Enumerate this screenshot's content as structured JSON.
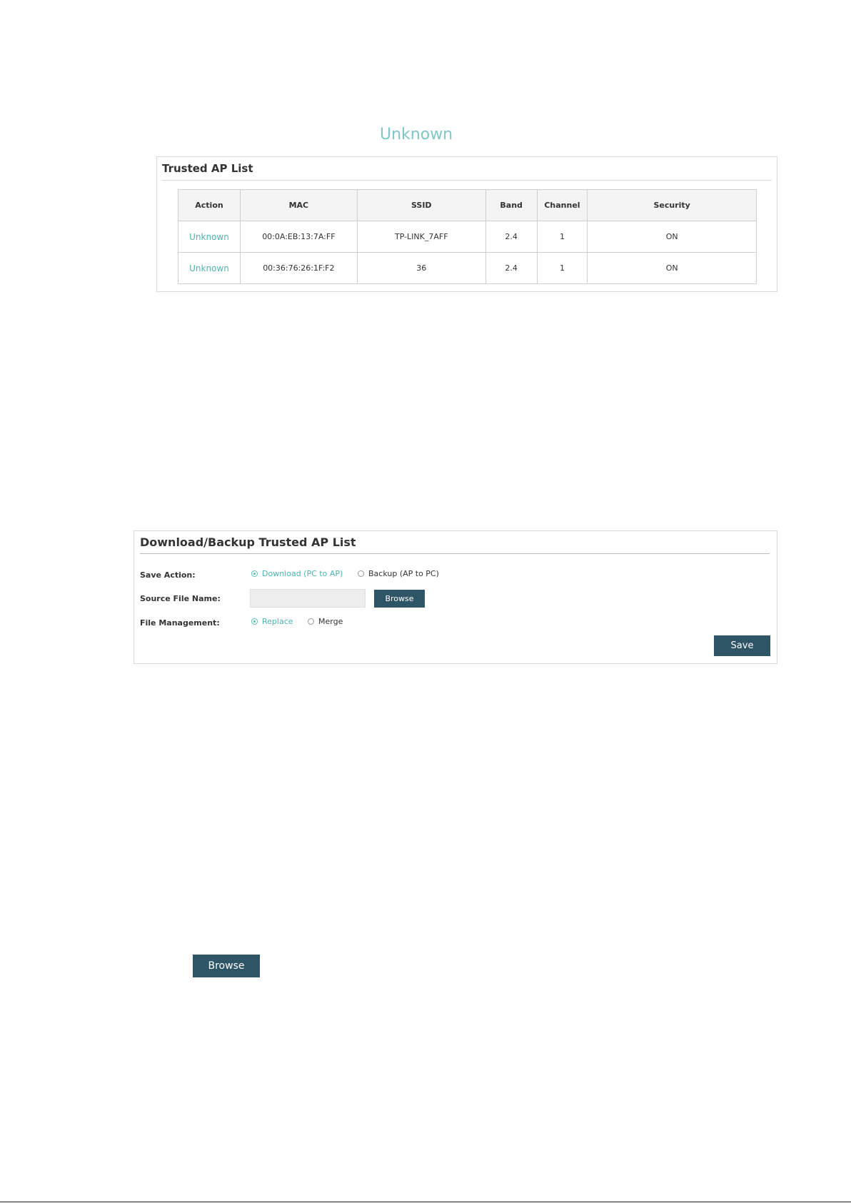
{
  "heading": "Unknown",
  "trusted_ap_list": {
    "title": "Trusted AP List",
    "columns": [
      "Action",
      "MAC",
      "SSID",
      "Band",
      "Channel",
      "Security"
    ],
    "rows": [
      {
        "action": "Unknown",
        "mac": "00:0A:EB:13:7A:FF",
        "ssid": "TP-LINK_7AFF",
        "band": "2.4",
        "channel": "1",
        "security": "ON"
      },
      {
        "action": "Unknown",
        "mac": "00:36:76:26:1F:F2",
        "ssid": "36",
        "band": "2.4",
        "channel": "1",
        "security": "ON"
      }
    ]
  },
  "backup_panel": {
    "title": "Download/Backup Trusted AP List",
    "save_action": {
      "label": "Save Action:",
      "options": [
        {
          "label": "Download (PC to AP)",
          "selected": true
        },
        {
          "label": "Backup (AP to PC)",
          "selected": false
        }
      ]
    },
    "source_file": {
      "label": "Source File Name:",
      "value": "",
      "browse_label": "Browse"
    },
    "file_management": {
      "label": "File Management:",
      "options": [
        {
          "label": "Replace",
          "selected": true
        },
        {
          "label": "Merge",
          "selected": false
        }
      ]
    },
    "save_label": "Save"
  },
  "standalone_browse_label": "Browse",
  "colors": {
    "accent": "#4fb3b0",
    "button": "#2e5566",
    "heading": "#7ec7c6"
  }
}
